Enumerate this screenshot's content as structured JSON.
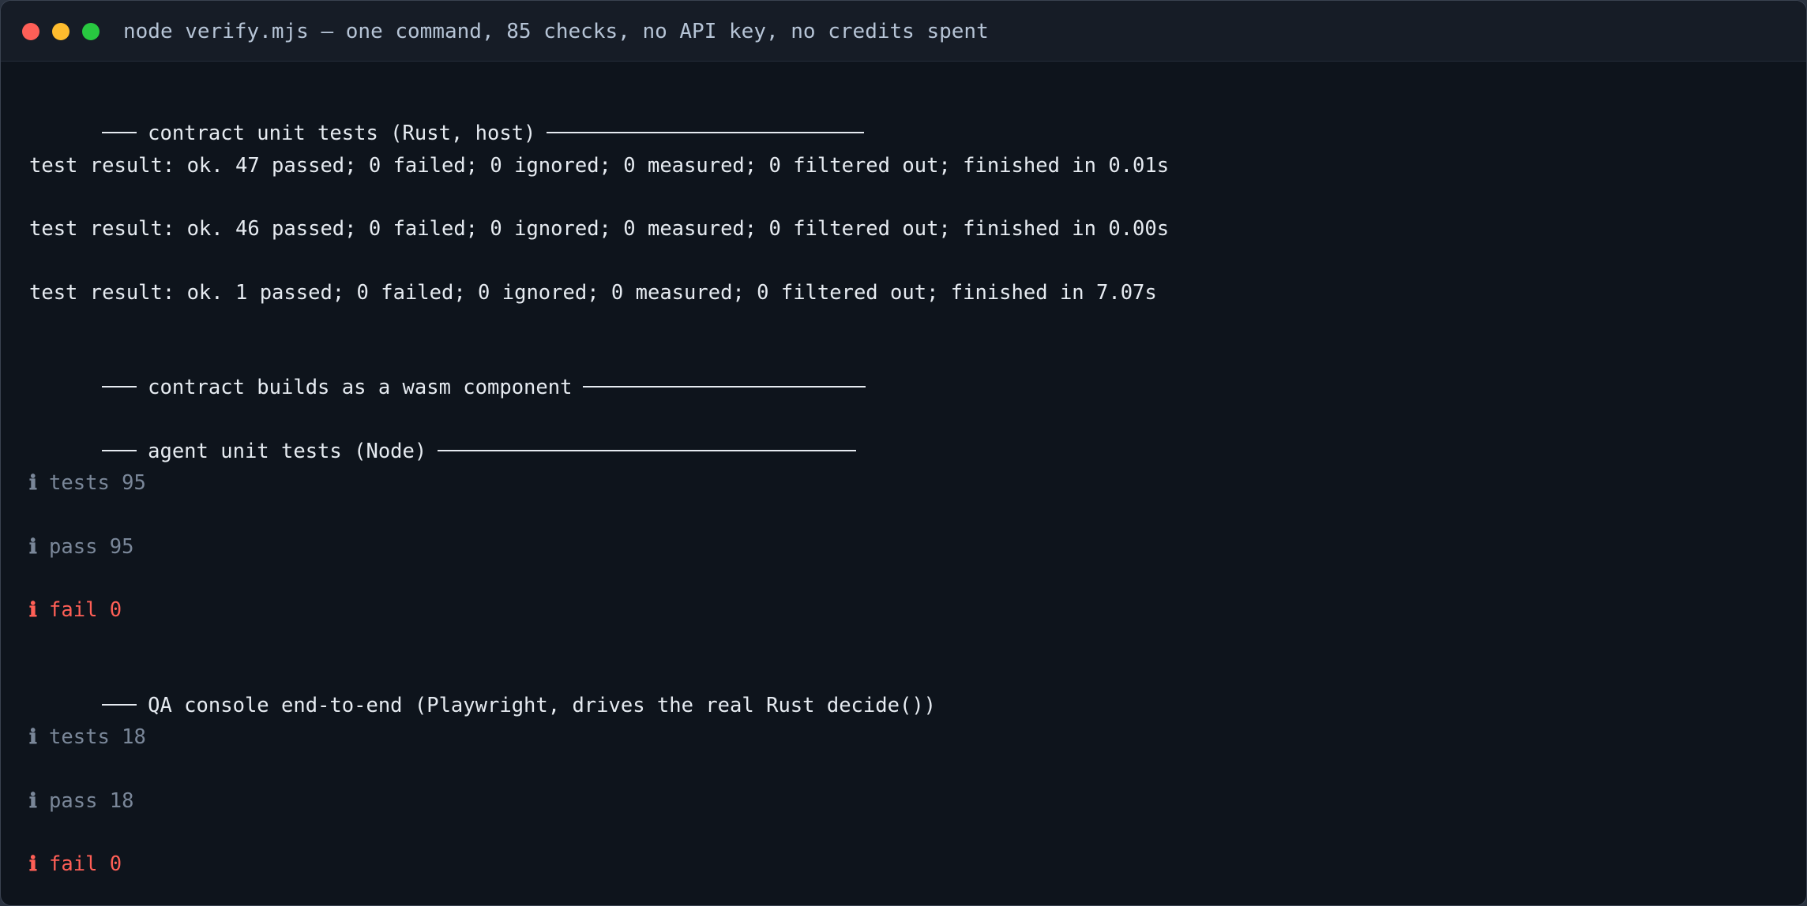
{
  "window": {
    "title": "node verify.mjs — one command, 85 checks, no API key, no credits spent"
  },
  "lines": [
    {
      "kind": "section",
      "text": "contract unit tests (Rust, host)"
    },
    {
      "kind": "plain",
      "text": "test result: ok. 47 passed; 0 failed; 0 ignored; 0 measured; 0 filtered out; finished in 0.01s"
    },
    {
      "kind": "plain",
      "text": "test result: ok. 46 passed; 0 failed; 0 ignored; 0 measured; 0 filtered out; finished in 0.00s"
    },
    {
      "kind": "plain",
      "text": "test result: ok. 1 passed; 0 failed; 0 ignored; 0 measured; 0 filtered out; finished in 7.07s"
    },
    {
      "kind": "section",
      "text": "contract builds as a wasm component"
    },
    {
      "kind": "section",
      "text": "agent unit tests (Node)"
    },
    {
      "kind": "info",
      "glyph": "ℹ",
      "text": "tests 95"
    },
    {
      "kind": "info",
      "glyph": "ℹ",
      "text": "pass 95"
    },
    {
      "kind": "fail",
      "glyph": "ℹ",
      "text": "fail 0"
    },
    {
      "kind": "section",
      "text": "QA console end-to-end (Playwright, drives the real Rust decide())"
    },
    {
      "kind": "info",
      "glyph": "ℹ",
      "text": "tests 18"
    },
    {
      "kind": "info",
      "glyph": "ℹ",
      "text": "pass 18"
    },
    {
      "kind": "fail",
      "glyph": "ℹ",
      "text": "fail 0"
    }
  ],
  "colors": {
    "background": "#0e141c",
    "titlebar": "#161c26",
    "text": "#e6ebf1",
    "info": "#7a8799",
    "fail": "#ff5f56",
    "close": "#fe5f57",
    "minimize": "#febc2e",
    "zoom": "#28c840"
  }
}
